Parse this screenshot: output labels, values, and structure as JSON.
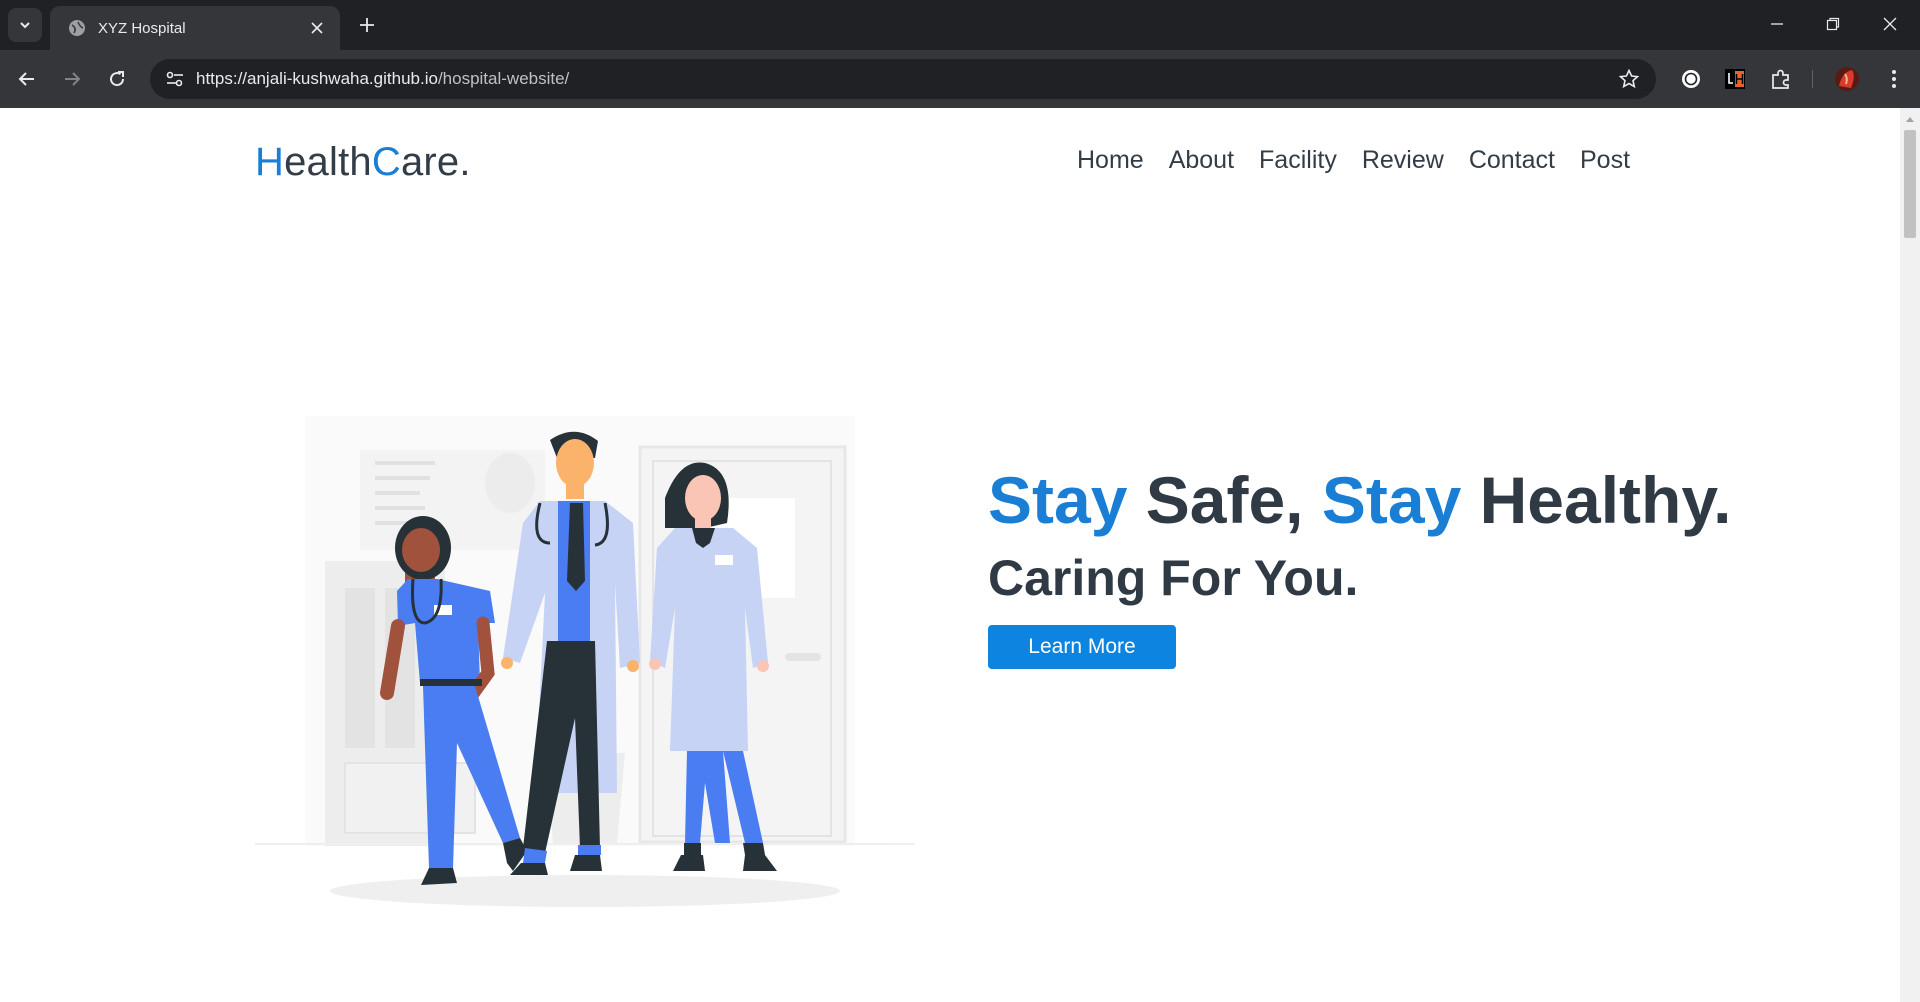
{
  "browser": {
    "tab_title": "XYZ Hospital",
    "url_host": "https://anjali-kushwaha.github.io",
    "url_path": "/hospital-website/",
    "icons": [
      "tab-search-icon",
      "globe-icon",
      "close-icon",
      "plus-icon",
      "minimize-icon",
      "restore-icon",
      "window-close-icon",
      "back-arrow-icon",
      "forward-arrow-icon",
      "reload-icon",
      "site-settings-icon",
      "bookmark-star-icon",
      "extension-icon",
      "lighthouse-icon",
      "puzzle-icon",
      "profile-avatar-icon",
      "menu-kebab-icon"
    ]
  },
  "site": {
    "logo": {
      "h": "H",
      "ealth": "ealth",
      "c": "C",
      "are": "are."
    },
    "nav": [
      "Home",
      "About",
      "Facility",
      "Review",
      "Contact",
      "Post"
    ],
    "hero": {
      "headline_stay1": "Stay",
      "headline_safe": " Safe, ",
      "headline_stay2": "Stay",
      "headline_healthy": " Healthy.",
      "subline": "Caring For You.",
      "button": "Learn More"
    }
  },
  "colors": {
    "accent": "#1a7fd4",
    "button": "#0d84e0",
    "text": "#2f3a45",
    "scrub_blue": "#4a7cf2",
    "coat": "#c6d3f5"
  }
}
